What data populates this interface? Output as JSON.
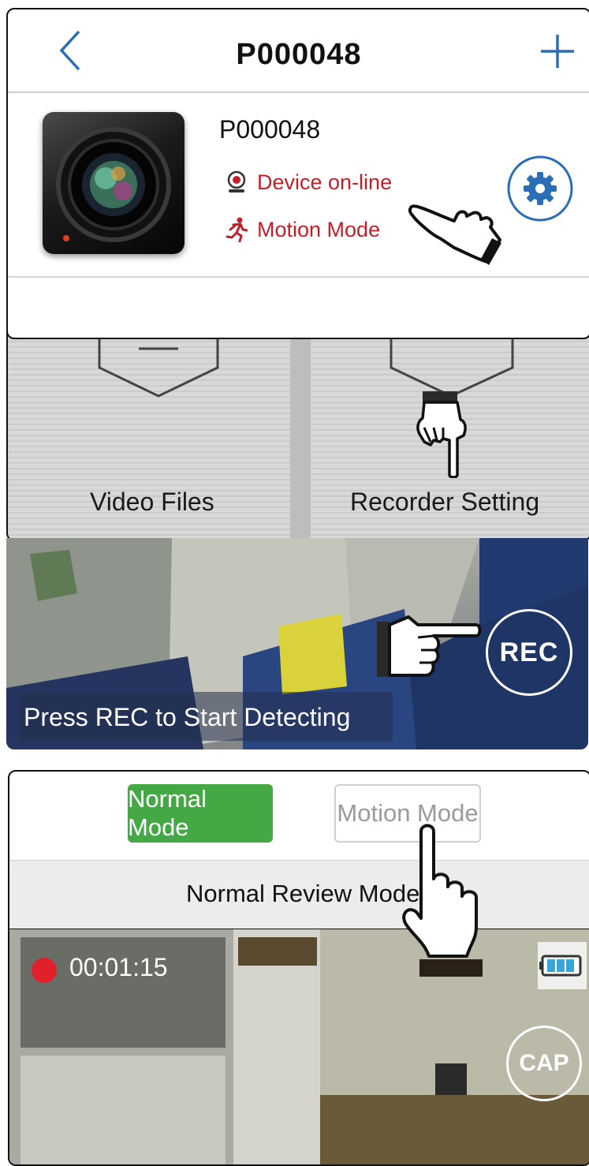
{
  "device_list": {
    "nav_title": "P000048",
    "device": {
      "name": "P000048",
      "status_online": "Device on-line",
      "status_mode": "Motion Mode"
    }
  },
  "menu": {
    "video_files_label": "Video Files",
    "recorder_setting_label": "Recorder Setting"
  },
  "live_view": {
    "caption": "Press REC to Start Detecting",
    "rec_label": "REC"
  },
  "mode_switch": {
    "normal_mode_label": "Normal Mode",
    "motion_mode_label": "Motion Mode",
    "review_mode_label": "Normal Review Mode",
    "timer": "00:01:15",
    "cap_label": "CAP"
  },
  "colors": {
    "status_red": "#c0202a",
    "accent_blue": "#2a6fb6",
    "normal_mode_green": "#44a844"
  },
  "icons": [
    "back-chevron-icon",
    "plus-icon",
    "camera-lens-icon",
    "webcam-icon",
    "running-man-icon",
    "gear-icon",
    "pointing-hand-icon",
    "battery-icon"
  ]
}
